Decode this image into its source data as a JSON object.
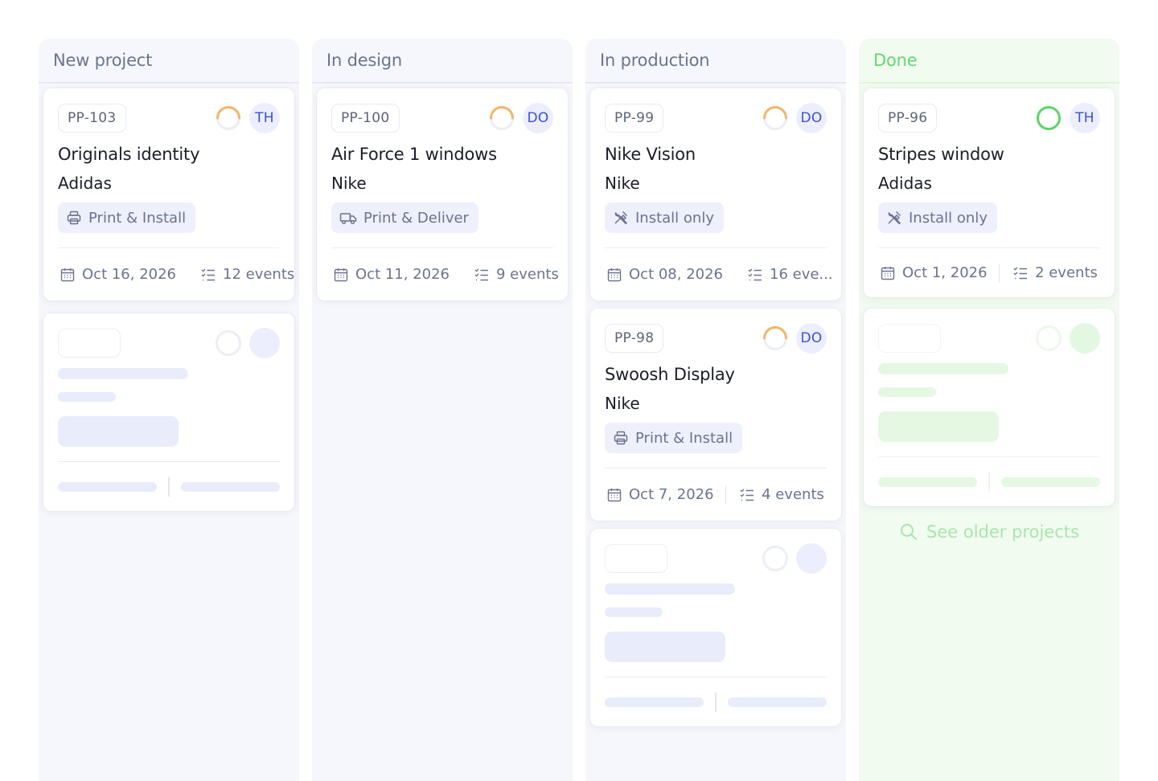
{
  "columns": [
    {
      "title": "New project",
      "cards": [
        {
          "id": "PP-103",
          "assignee": "TH",
          "title": "Originals identity",
          "client": "Adidas",
          "service": "Print & Install",
          "service_icon": "printer-icon",
          "date": "Oct 16, 2026",
          "events": "12 events",
          "progress": 0.25
        }
      ]
    },
    {
      "title": "In design",
      "cards": [
        {
          "id": "PP-100",
          "assignee": "DO",
          "title": "Air Force 1 windows",
          "client": "Nike",
          "service": "Print & Deliver",
          "service_icon": "truck-icon",
          "date": "Oct 11, 2026",
          "events": "9 events",
          "progress": 0.25
        }
      ]
    },
    {
      "title": "In production",
      "cards": [
        {
          "id": "PP-99",
          "assignee": "DO",
          "title": "Nike Vision",
          "client": "Nike",
          "service": "Install only",
          "service_icon": "tools-icon",
          "date": "Oct 08, 2026",
          "events": "16 eve...",
          "progress": 0.25
        },
        {
          "id": "PP-98",
          "assignee": "DO",
          "title": "Swoosh Display",
          "client": "Nike",
          "service": "Print & Install",
          "service_icon": "printer-icon",
          "date": "Oct 7, 2026",
          "events": "4 events",
          "progress": 0.25
        }
      ]
    },
    {
      "title": "Done",
      "cards": [
        {
          "id": "PP-96",
          "assignee": "TH",
          "title": "Stripes window",
          "client": "Adidas",
          "service": "Install only",
          "service_icon": "tools-icon",
          "date": "Oct 1, 2026",
          "events": "2 events",
          "progress": 1.0
        }
      ]
    }
  ],
  "see_older_label": "See older projects",
  "colors": {
    "accent": "#3b4fd8",
    "progress_partial": "#f2b56b",
    "progress_done": "#5ed36b",
    "done_text": "#62d672"
  }
}
